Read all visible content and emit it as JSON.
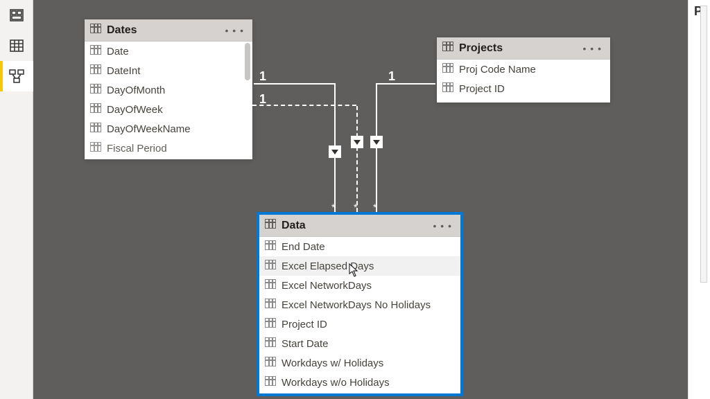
{
  "sidebar": {
    "icons": [
      "report-view",
      "data-view",
      "model-view"
    ],
    "active": "model-view"
  },
  "right_strip": "P",
  "tables": {
    "dates": {
      "title": "Dates",
      "more": "• • •",
      "fields": [
        "Date",
        "DateInt",
        "DayOfMonth",
        "DayOfWeek",
        "DayOfWeekName",
        "Fiscal Period"
      ]
    },
    "projects": {
      "title": "Projects",
      "more": "• • •",
      "fields": [
        "Proj Code Name",
        "Project ID"
      ]
    },
    "data": {
      "title": "Data",
      "more": "• • •",
      "fields": [
        "End Date",
        "Excel Elapsed Days",
        "Excel NetworkDays",
        "Excel NetworkDays No Holidays",
        "Project ID",
        "Start Date",
        "Workdays w/ Holidays",
        "Workdays w/o Holidays"
      ]
    }
  },
  "cardinality": {
    "one": "1",
    "many": "*"
  }
}
